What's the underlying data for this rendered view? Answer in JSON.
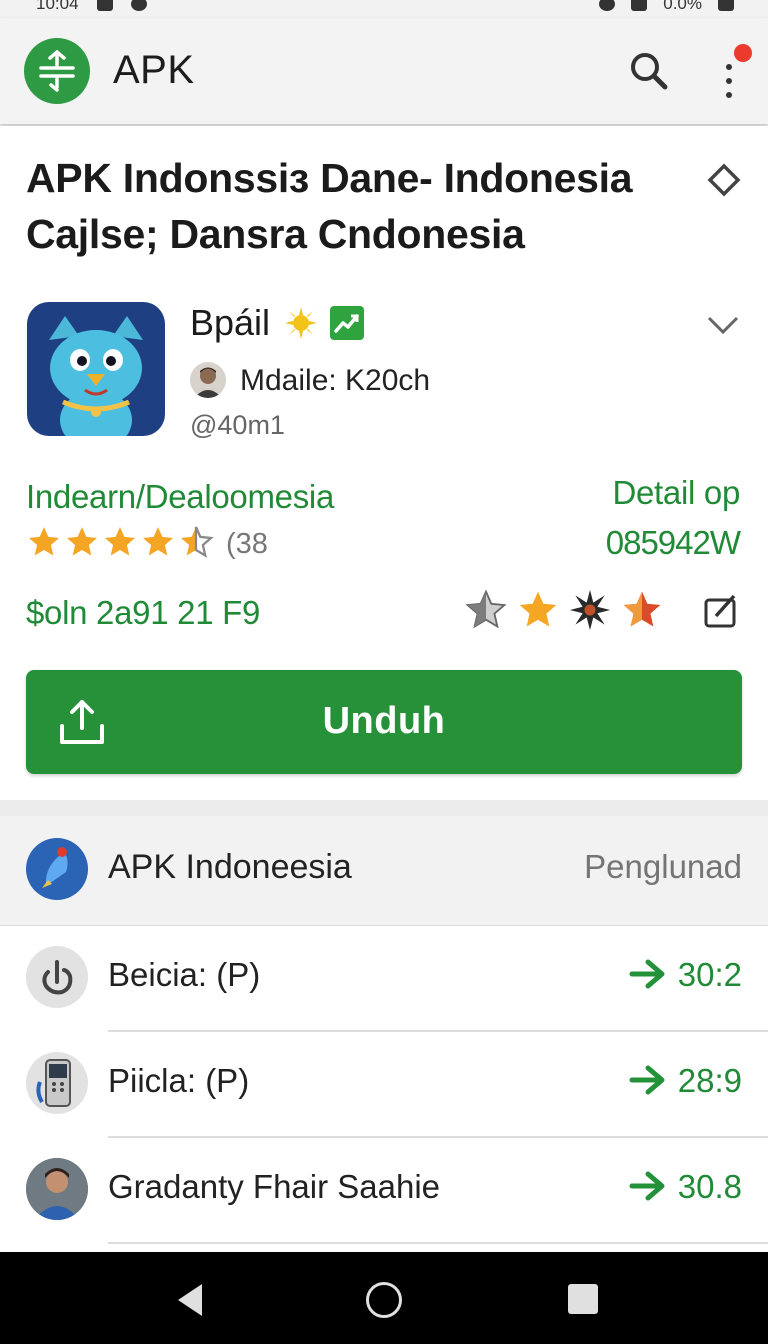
{
  "status_bar": {
    "time": "10:04",
    "battery": "0.0%"
  },
  "app_bar": {
    "title": "APK",
    "logo_icon": "apk-logo-icon",
    "search_icon": "search-icon",
    "menu_icon": "more-vert-icon",
    "notification_badge_color": "#ea3b2e"
  },
  "app_detail": {
    "headline_line1": "APK Indonssiз Dane- Indonesia",
    "headline_line2": "Cajlse; Dansra Cndonesia",
    "app_name": "Bpáil",
    "developer_label": "Mdaile: K20ch",
    "developer_handle": "@40m1",
    "category_link": "Indearn/Dealoomesia",
    "detail_link": "Detail op",
    "rating_stars": 4.5,
    "rating_count": "(38",
    "size_value": "085942W",
    "price_text": "$oln 2a91 21 F9",
    "download_label": "Unduh",
    "accent_color": "#27913a",
    "link_color": "#218a37"
  },
  "list": {
    "header_title": "APK Indoneesia",
    "header_action": "Penglunad",
    "rows": [
      {
        "label": "Beicia: (P)",
        "value": "30:2",
        "icon": "power-icon"
      },
      {
        "label": "Piicla: (P)",
        "value": "28:9",
        "icon": "phone-icon"
      },
      {
        "label": "Gradanty Fhair Saahie",
        "value": "30.8",
        "icon": "avatar"
      }
    ]
  },
  "nav_bar": {
    "back_icon": "back-icon",
    "home_icon": "home-icon",
    "recent_icon": "recent-apps-icon"
  }
}
